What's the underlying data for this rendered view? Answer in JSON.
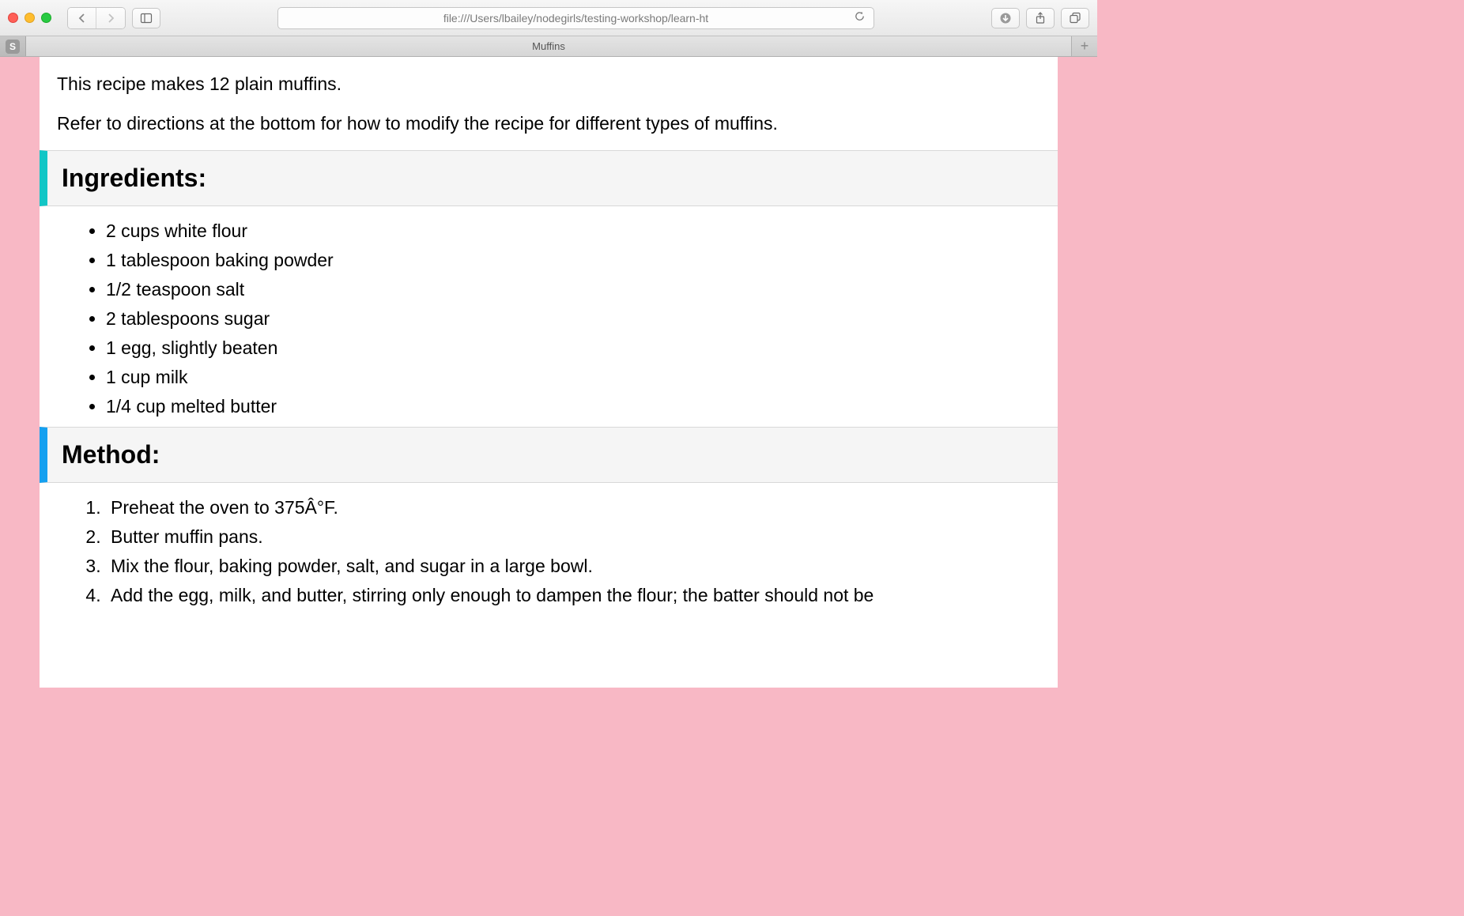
{
  "browser": {
    "url": "file:///Users/lbailey/nodegirls/testing-workshop/learn-ht",
    "tab_title": "Muffins",
    "favorite_badge": "S"
  },
  "page": {
    "intro1": "This recipe makes 12 plain muffins.",
    "intro2": "Refer to directions at the bottom for how to modify the recipe for different types of muffins.",
    "ingredients_heading": "Ingredients:",
    "ingredients": [
      "2 cups white flour",
      "1 tablespoon baking powder",
      "1/2 teaspoon salt",
      "2 tablespoons sugar",
      "1 egg, slightly beaten",
      "1 cup milk",
      "1/4 cup melted butter"
    ],
    "method_heading": "Method:",
    "method_steps": [
      "Preheat the oven to 375Â°F.",
      "Butter muffin pans.",
      "Mix the flour, baking powder, salt, and sugar in a large bowl.",
      "Add the egg, milk, and butter, stirring only enough to dampen the flour; the batter should not be"
    ]
  }
}
